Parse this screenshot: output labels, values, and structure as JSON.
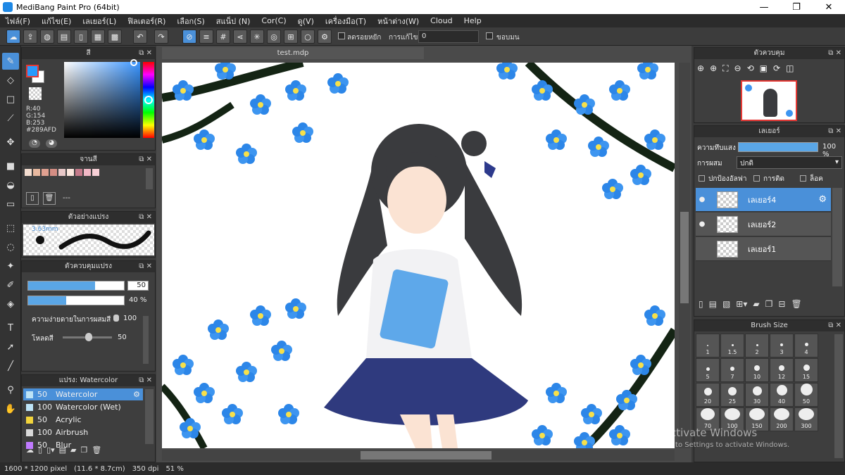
{
  "window": {
    "title": "MediBang Paint Pro (64bit)",
    "minimize": "—",
    "maximize": "❐",
    "close": "✕"
  },
  "menu": [
    "ไฟล์(F)",
    "แก้ไข(E)",
    "เลเยอร์(L)",
    "ฟิลเตอร์(R)",
    "เลือก(S)",
    "สแน็ป (N)",
    "Cor(C)",
    "ดู(V)",
    "เครื่องมือ(T)",
    "หน้าต่าง(W)",
    "Cloud",
    "Help"
  ],
  "toolbar": {
    "antialias_label": "ลดรอยหยัก",
    "correction_label": "การแก้ไข",
    "correction_value": "0",
    "edge_label": "ขอบมน"
  },
  "color_panel": {
    "title": "สี",
    "r": "R:40",
    "g": "G:154",
    "b": "B:253",
    "hex": "#289AFD"
  },
  "palette_panel": {
    "title": "จานสี",
    "none_label": "---",
    "swatches": [
      "#f3ddd0",
      "#e8b9a0",
      "#e0a090",
      "#d58e84",
      "#e8c8c8",
      "#fbe6dd",
      "#c47a8a",
      "#f2b8c6",
      "#f7cfd6"
    ]
  },
  "preview_panel": {
    "title": "ตัวอย่างแปรง",
    "size": "3.63mm"
  },
  "control_panel": {
    "title": "ตัวควบคุมแปรง",
    "size_value": "50",
    "size_fill": 0.7,
    "opacity_value": "40 %",
    "opacity_fill": 0.4,
    "blend_label": "ความง่ายดายในการผสมสี",
    "blend_value": "100",
    "load_label": "โหลดสี",
    "load_value": "50"
  },
  "brushlist_panel": {
    "title": "แปรง: Watercolor",
    "brushes": [
      {
        "size": "50",
        "name": "Watercolor",
        "color": "#bde3f6",
        "selected": true
      },
      {
        "size": "100",
        "name": "Watercolor (Wet)",
        "color": "#bde3f6",
        "selected": false
      },
      {
        "size": "50",
        "name": "Acrylic",
        "color": "#f2d43b",
        "selected": false
      },
      {
        "size": "100",
        "name": "Airbrush",
        "color": "#d9d9d9",
        "selected": false
      },
      {
        "size": "50",
        "name": "Blur",
        "color": "#c07aff",
        "selected": false
      }
    ]
  },
  "canvas": {
    "tab": "test.mdp"
  },
  "nav_panel": {
    "title": "ตัวควบคุม"
  },
  "layer_panel": {
    "title": "เลเยอร์",
    "opacity_label": "ความทึบแสง",
    "opacity_value": "100 %",
    "opacity_fill": 1.0,
    "blend_label": "การผสม",
    "blend_value": "ปกติ",
    "protect_label": "ปกป้องอัลฟา",
    "clip_label": "การติด",
    "lock_label": "ล็อค",
    "layers": [
      {
        "name": "เลเยอร์4",
        "visible": "●",
        "selected": true
      },
      {
        "name": "เลเยอร์2",
        "visible": "●",
        "selected": false
      },
      {
        "name": "เลเยอร์1",
        "visible": "",
        "selected": false
      }
    ]
  },
  "bsize_panel": {
    "title": "Brush Size",
    "sizes": [
      "1",
      "1.5",
      "2",
      "3",
      "4",
      "5",
      "7",
      "10",
      "12",
      "15",
      "20",
      "25",
      "30",
      "40",
      "50",
      "70",
      "100",
      "150",
      "200",
      "300"
    ]
  },
  "status": {
    "pixels": "1600 * 1200 pixel",
    "cm": "(11.6 * 8.7cm)",
    "dpi": "350 dpi",
    "zoom": "51 %"
  },
  "activation": {
    "title": "Activate Windows",
    "subtitle": "Go to Settings to activate Windows."
  },
  "colors": {
    "accent": "#4a90d9",
    "fg": "#289AFD"
  }
}
